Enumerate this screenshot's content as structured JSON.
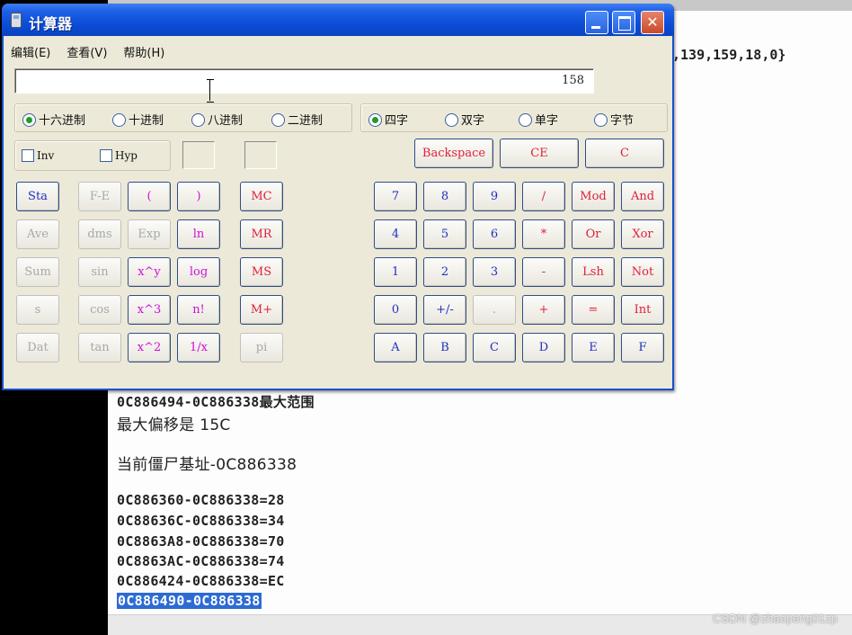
{
  "editor": {
    "top_right_text": ",139,159,18,0}",
    "lines": [
      "0C886494-0C886338最大范围",
      "最大偏移是 15C",
      "当前僵尸基址-0C886338",
      "0C886360-0C886338=28",
      "0C88636C-0C886338=34",
      "0C8863A8-0C886338=70",
      "0C8863AC-0C886338=74",
      "0C886424-0C886338=EC"
    ],
    "selected_line": "0C886490-0C886338"
  },
  "watermark": "CSDN @zhaopeng01zp",
  "calculator": {
    "title": "计算器",
    "window_buttons": [
      "minimize-icon",
      "maximize-icon",
      "close-icon"
    ],
    "close_glyph": "✕",
    "menu": [
      "编辑(E)",
      "查看(V)",
      "帮助(H)"
    ],
    "display_value": "158",
    "base_options": [
      {
        "label": "十六进制",
        "selected": true
      },
      {
        "label": "十进制",
        "selected": false
      },
      {
        "label": "八进制",
        "selected": false
      },
      {
        "label": "二进制",
        "selected": false
      }
    ],
    "word_options": [
      {
        "label": "四字",
        "selected": true
      },
      {
        "label": "双字",
        "selected": false
      },
      {
        "label": "单字",
        "selected": false
      },
      {
        "label": "字节",
        "selected": false
      }
    ],
    "checkboxes": [
      {
        "label": "Inv",
        "checked": false
      },
      {
        "label": "Hyp",
        "checked": false
      }
    ],
    "edit_keys": [
      "Backspace",
      "CE",
      "C"
    ],
    "sci_col1": [
      "Sta",
      "Ave",
      "Sum",
      "s",
      "Dat"
    ],
    "sci_col2": [
      "F-E",
      "dms",
      "sin",
      "cos",
      "tan"
    ],
    "sci_col3": [
      "(",
      "Exp",
      "x^y",
      "x^3",
      "x^2"
    ],
    "sci_col4": [
      ")",
      "ln",
      "log",
      "n!",
      "1/x"
    ],
    "mem_col": [
      "MC",
      "MR",
      "MS",
      "M+",
      "pi"
    ],
    "numpad": [
      [
        "7",
        "8",
        "9",
        "/",
        "Mod",
        "And"
      ],
      [
        "4",
        "5",
        "6",
        "*",
        "Or",
        "Xor"
      ],
      [
        "1",
        "2",
        "3",
        "-",
        "Lsh",
        "Not"
      ],
      [
        "0",
        "+/-",
        ".",
        "+",
        "=",
        "Int"
      ],
      [
        "A",
        "B",
        "C",
        "D",
        "E",
        "F"
      ]
    ]
  }
}
